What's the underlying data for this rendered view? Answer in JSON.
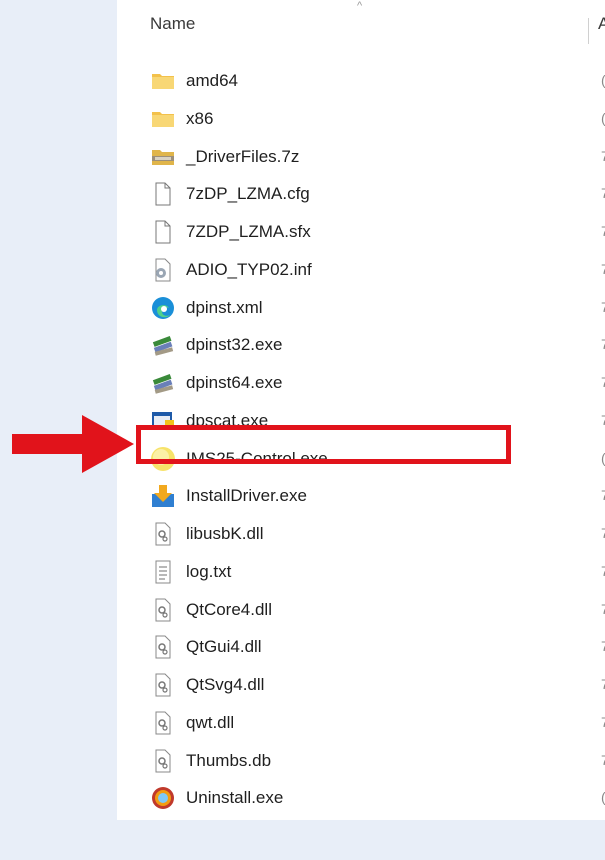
{
  "header": {
    "name_label": "Name",
    "sort_indicator": "^",
    "next_column_label": "A"
  },
  "files": [
    {
      "name": "amd64",
      "icon": "folder-icon",
      "trail": "("
    },
    {
      "name": "x86",
      "icon": "folder-icon",
      "trail": "("
    },
    {
      "name": "_DriverFiles.7z",
      "icon": "archive-icon",
      "trail": "7"
    },
    {
      "name": "7zDP_LZMA.cfg",
      "icon": "blank-file-icon",
      "trail": "7"
    },
    {
      "name": "7ZDP_LZMA.sfx",
      "icon": "blank-file-icon",
      "trail": "7"
    },
    {
      "name": "ADIO_TYP02.inf",
      "icon": "setup-info-icon",
      "trail": "7"
    },
    {
      "name": "dpinst.xml",
      "icon": "edge-icon",
      "trail": "7"
    },
    {
      "name": "dpinst32.exe",
      "icon": "installer-icon",
      "trail": "7"
    },
    {
      "name": "dpinst64.exe",
      "icon": "installer-icon",
      "trail": "7"
    },
    {
      "name": "dpscat.exe",
      "icon": "app-window-icon",
      "trail": "7"
    },
    {
      "name": "IMS25-Control.exe",
      "icon": "yellow-circle-icon",
      "trail": "("
    },
    {
      "name": "InstallDriver.exe",
      "icon": "download-install-icon",
      "trail": "7"
    },
    {
      "name": "libusbK.dll",
      "icon": "dll-icon",
      "trail": "7"
    },
    {
      "name": "log.txt",
      "icon": "text-file-icon",
      "trail": "7"
    },
    {
      "name": "QtCore4.dll",
      "icon": "dll-icon",
      "trail": "7"
    },
    {
      "name": "QtGui4.dll",
      "icon": "dll-icon",
      "trail": "7"
    },
    {
      "name": "QtSvg4.dll",
      "icon": "dll-icon",
      "trail": "7"
    },
    {
      "name": "qwt.dll",
      "icon": "dll-icon",
      "trail": "7"
    },
    {
      "name": "Thumbs.db",
      "icon": "dll-icon",
      "trail": "7"
    },
    {
      "name": "Uninstall.exe",
      "icon": "uninstall-icon",
      "trail": "("
    }
  ],
  "annotation": {
    "highlight_color": "#e1131b",
    "highlighted_file": "IMS25-Control.exe"
  }
}
